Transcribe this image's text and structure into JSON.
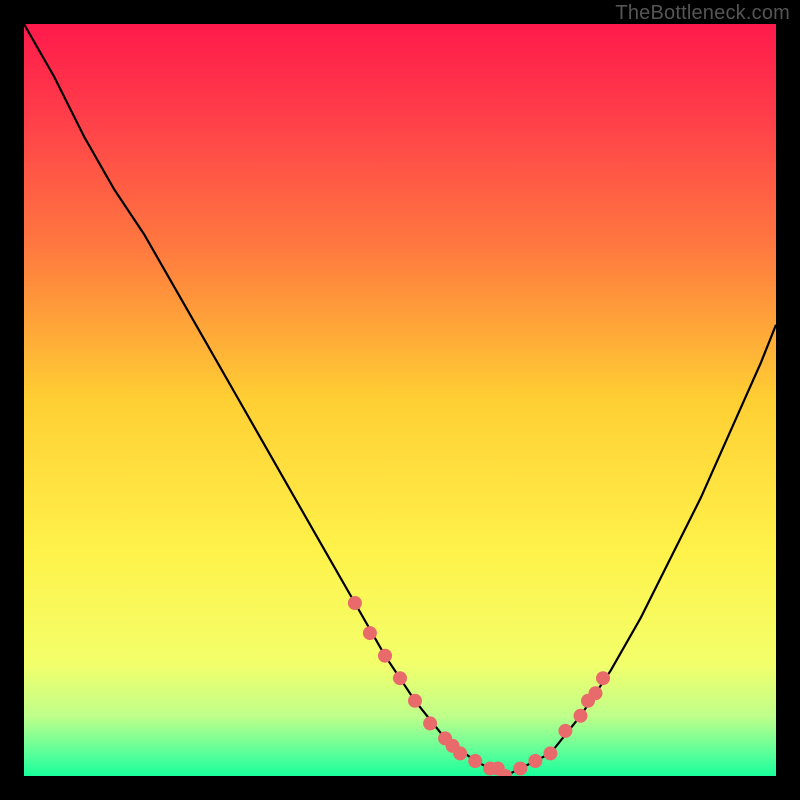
{
  "watermark": "TheBottleneck.com",
  "chart_data": {
    "type": "line",
    "title": "",
    "xlabel": "",
    "ylabel": "",
    "xlim": [
      0,
      100
    ],
    "ylim": [
      0,
      100
    ],
    "background_gradient": {
      "stops": [
        {
          "offset": 0.0,
          "color": "#ff1a4b"
        },
        {
          "offset": 0.12,
          "color": "#ff3d4a"
        },
        {
          "offset": 0.3,
          "color": "#ff7a3f"
        },
        {
          "offset": 0.5,
          "color": "#ffcf33"
        },
        {
          "offset": 0.7,
          "color": "#fff24a"
        },
        {
          "offset": 0.85,
          "color": "#f3ff6a"
        },
        {
          "offset": 0.92,
          "color": "#bfff8a"
        },
        {
          "offset": 0.97,
          "color": "#5aff9a"
        },
        {
          "offset": 1.0,
          "color": "#18ff9a"
        }
      ]
    },
    "series": [
      {
        "name": "bottleneck-curve",
        "color": "#000000",
        "x": [
          0,
          4,
          8,
          12,
          16,
          20,
          24,
          28,
          32,
          36,
          40,
          44,
          48,
          52,
          56,
          60,
          62,
          64,
          66,
          70,
          74,
          78,
          82,
          86,
          90,
          94,
          98,
          100
        ],
        "y": [
          100,
          93,
          85,
          78,
          72,
          65,
          58,
          51,
          44,
          37,
          30,
          23,
          16,
          10,
          5,
          2,
          1,
          0,
          1,
          3,
          8,
          14,
          21,
          29,
          37,
          46,
          55,
          60
        ]
      }
    ],
    "markers": {
      "name": "highlight-points",
      "color": "#e96a6a",
      "radius_px": 7,
      "points": [
        {
          "x": 44,
          "y": 23
        },
        {
          "x": 46,
          "y": 19
        },
        {
          "x": 48,
          "y": 16
        },
        {
          "x": 50,
          "y": 13
        },
        {
          "x": 52,
          "y": 10
        },
        {
          "x": 54,
          "y": 7
        },
        {
          "x": 56,
          "y": 5
        },
        {
          "x": 57,
          "y": 4
        },
        {
          "x": 58,
          "y": 3
        },
        {
          "x": 60,
          "y": 2
        },
        {
          "x": 62,
          "y": 1
        },
        {
          "x": 63,
          "y": 1
        },
        {
          "x": 64,
          "y": 0
        },
        {
          "x": 66,
          "y": 1
        },
        {
          "x": 68,
          "y": 2
        },
        {
          "x": 70,
          "y": 3
        },
        {
          "x": 72,
          "y": 6
        },
        {
          "x": 74,
          "y": 8
        },
        {
          "x": 75,
          "y": 10
        },
        {
          "x": 76,
          "y": 11
        },
        {
          "x": 77,
          "y": 13
        }
      ]
    }
  }
}
